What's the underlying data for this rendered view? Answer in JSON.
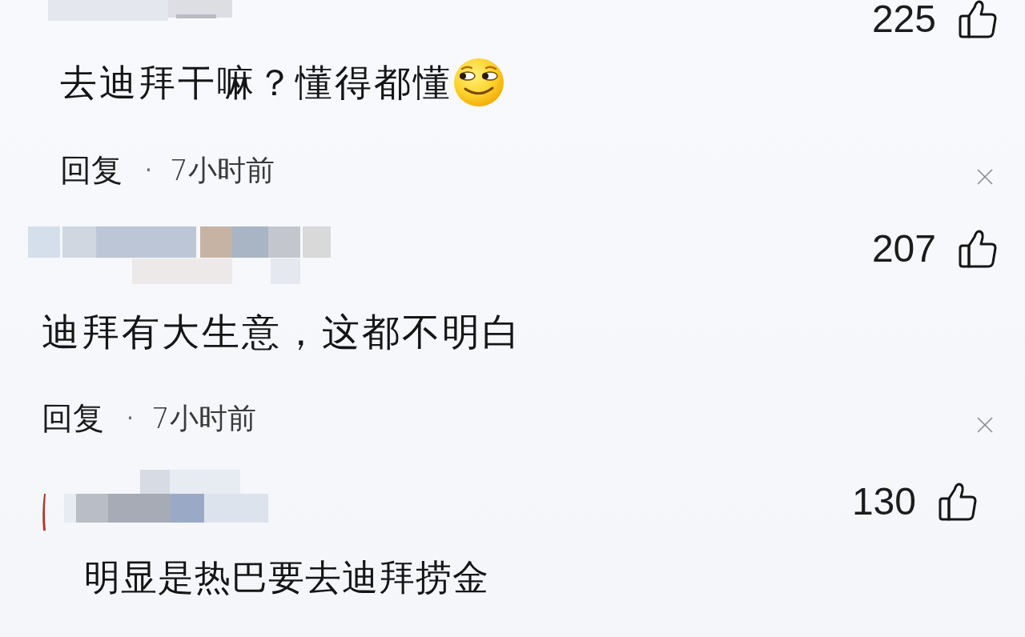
{
  "comments": [
    {
      "likes": "225",
      "text": "去迪拜干嘛？懂得都懂",
      "emoji": true,
      "reply": "回复",
      "separator": "·",
      "time": "7小时前"
    },
    {
      "likes": "207",
      "text": "迪拜有大生意，这都不明白",
      "emoji": false,
      "reply": "回复",
      "separator": "·",
      "time": "7小时前"
    },
    {
      "likes": "130",
      "text": "明显是热巴要去迪拜捞金",
      "emoji": false
    }
  ]
}
